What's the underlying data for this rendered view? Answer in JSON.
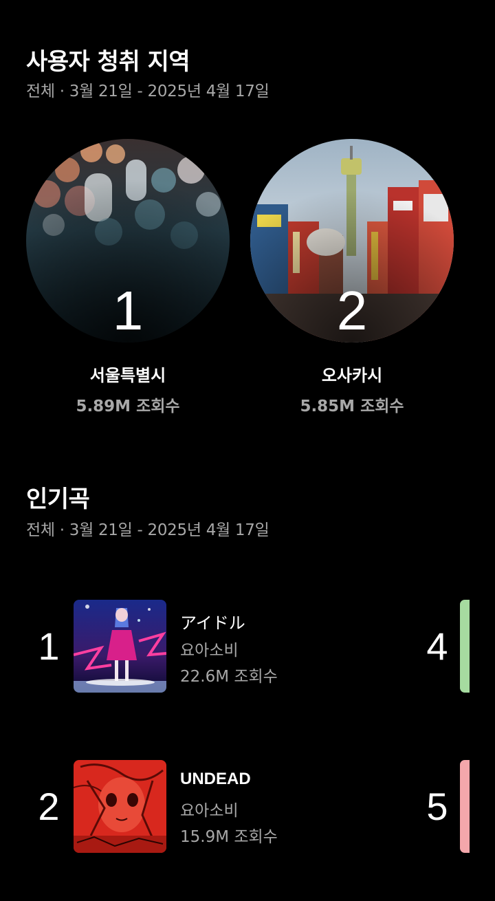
{
  "regions_section": {
    "title": "사용자 청취 지역",
    "subtitle": "전체 · 3월 21일 - 2025년 4월 17일",
    "items": [
      {
        "rank": "1",
        "name": "서울특별시",
        "views": "5.89M 조회수"
      },
      {
        "rank": "2",
        "name": "오사카시",
        "views": "5.85M 조회수"
      }
    ]
  },
  "songs_section": {
    "title": "인기곡",
    "subtitle": "전체 · 3월 21일 - 2025년 4월 17일",
    "items": [
      {
        "rank": "1",
        "title": "アイドル",
        "artist": "요아소비",
        "views": "22.6M 조회수"
      },
      {
        "rank": "2",
        "title": "UNDEAD",
        "artist": "요아소비",
        "views": "15.9M 조회수"
      }
    ],
    "next_column_ranks": [
      "4",
      "5"
    ],
    "peek_colors": [
      "#a6dba0",
      "#f4a7ab"
    ]
  },
  "colors": {
    "background": "#000000",
    "text_primary": "#ffffff",
    "text_secondary": "#a8a8a8"
  }
}
